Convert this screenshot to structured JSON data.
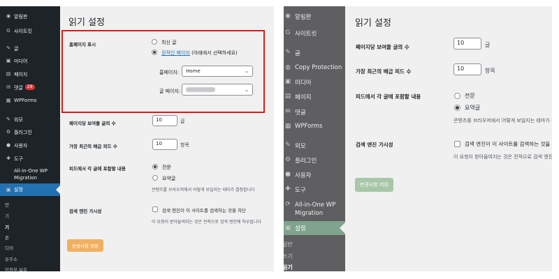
{
  "left": {
    "sidebar": {
      "items": [
        {
          "icon": "dashboard-icon",
          "glyph": "◉",
          "label": "알림판"
        },
        {
          "icon": "site-kit-icon",
          "glyph": "G",
          "label": "사이트킷"
        },
        {
          "icon": "posts-icon",
          "glyph": "✎",
          "label": "글"
        },
        {
          "icon": "media-icon",
          "glyph": "▣",
          "label": "미디어"
        },
        {
          "icon": "pages-icon",
          "glyph": "▤",
          "label": "페이지"
        },
        {
          "icon": "comments-icon",
          "glyph": "✉",
          "label": "댓글",
          "badge": "29"
        },
        {
          "icon": "wpforms-icon",
          "glyph": "▦",
          "label": "WPForms"
        },
        {
          "icon": "appearance-icon",
          "glyph": "✎",
          "label": "외모"
        },
        {
          "icon": "plugins-icon",
          "glyph": "⚙",
          "label": "플러그인"
        },
        {
          "icon": "users-icon",
          "glyph": "●",
          "label": "사용자"
        },
        {
          "icon": "tools-icon",
          "glyph": "✚",
          "label": "도구"
        },
        {
          "icon": "migration-icon",
          "glyph": "",
          "label": "All-in-One WP"
        },
        {
          "icon": "",
          "glyph": "",
          "label": "Migration"
        },
        {
          "icon": "settings-icon",
          "glyph": "▣",
          "label": "설정",
          "current": true
        }
      ],
      "subitems": [
        "반",
        "기",
        "기",
        "론",
        "디어",
        "유주소",
        "이정부 보호"
      ]
    },
    "title": "읽기 설정",
    "homepage": {
      "label": "홈페이지 표시",
      "opt_latest": "최신 글",
      "opt_static_link": "정적인 페이지",
      "opt_static_note": " (아래에서 선택하세요)",
      "homepage_label": "홈페이지:",
      "homepage_value": "Home",
      "posts_page_label": "글 페이지:"
    },
    "posts_per_page": {
      "label": "페이지당 보여줄 글의 수",
      "value": "10",
      "suffix": "글"
    },
    "feed_items": {
      "label": "가장 최근의 배급 피드 수",
      "value": "10",
      "suffix": "항목"
    },
    "feed_content": {
      "label": "피드에서 각 글에 포함할 내용",
      "opt_full": "전문",
      "opt_summary": "요약글",
      "help": "콘텐츠를 브라우저에서 어떻게 보일지는 테마가 결정합니다"
    },
    "search": {
      "label": "검색 엔진 가시성",
      "checkbox_label": "검색 엔진이 이 사이트를 검색하는 것을 차단",
      "help": "이 요청이 받아들여지는 것은 전적으로 검색 엔진에 하우립니다"
    },
    "save_label": "변경사항 저장"
  },
  "right": {
    "sidebar": {
      "items": [
        {
          "icon": "dashboard-icon",
          "glyph": "◉",
          "label": "알림판"
        },
        {
          "icon": "site-kit-icon",
          "glyph": "G",
          "label": "사이트킷"
        },
        {
          "icon": "posts-icon",
          "glyph": "✎",
          "label": "글"
        },
        {
          "icon": "copy-protection-icon",
          "glyph": "◍",
          "label": "Copy Protection"
        },
        {
          "icon": "media-icon",
          "glyph": "▣",
          "label": "미디어"
        },
        {
          "icon": "pages-icon",
          "glyph": "▤",
          "label": "페이지"
        },
        {
          "icon": "comments-icon",
          "glyph": "✉",
          "label": "댓글"
        },
        {
          "icon": "wpforms-icon",
          "glyph": "▦",
          "label": "WPForms"
        },
        {
          "icon": "appearance-icon",
          "glyph": "✎",
          "label": "외모"
        },
        {
          "icon": "plugins-icon",
          "glyph": "⚙",
          "label": "플러그인"
        },
        {
          "icon": "users-icon",
          "glyph": "●",
          "label": "사용자"
        },
        {
          "icon": "tools-icon",
          "glyph": "✚",
          "label": "도구"
        },
        {
          "icon": "migration-icon",
          "glyph": "⟳",
          "label": "All-in-One WP"
        },
        {
          "icon": "",
          "glyph": "",
          "label": "Migration"
        },
        {
          "icon": "settings-icon",
          "glyph": "▣",
          "label": "설정",
          "current": true
        }
      ],
      "subitems": [
        "일반",
        "쓰기",
        "읽기"
      ]
    },
    "title": "읽기 설정",
    "posts_per_page": {
      "label": "페이지당 보여줄 글의 수",
      "value": "10",
      "suffix": "글"
    },
    "feed_items": {
      "label": "가장 최근의 배급 피드 수",
      "value": "10",
      "suffix": "항목"
    },
    "feed_content": {
      "label": "피드에서 각 글에 포함할 내용",
      "opt_full": "전문",
      "opt_summary": "요약글",
      "help": "콘텐츠를 브라우저에서 어떻게 보일지는 테마가 결정합니다"
    },
    "search": {
      "label": "검색 엔진 가시성",
      "checkbox_label": "검색 엔진이 이 사이트를 검색하는 것을 차단",
      "help": "이 요청이 받아들여지는 것은 전적으로 검색 엔진에 달렸습니다"
    },
    "save_label": "변경사항 저장"
  }
}
